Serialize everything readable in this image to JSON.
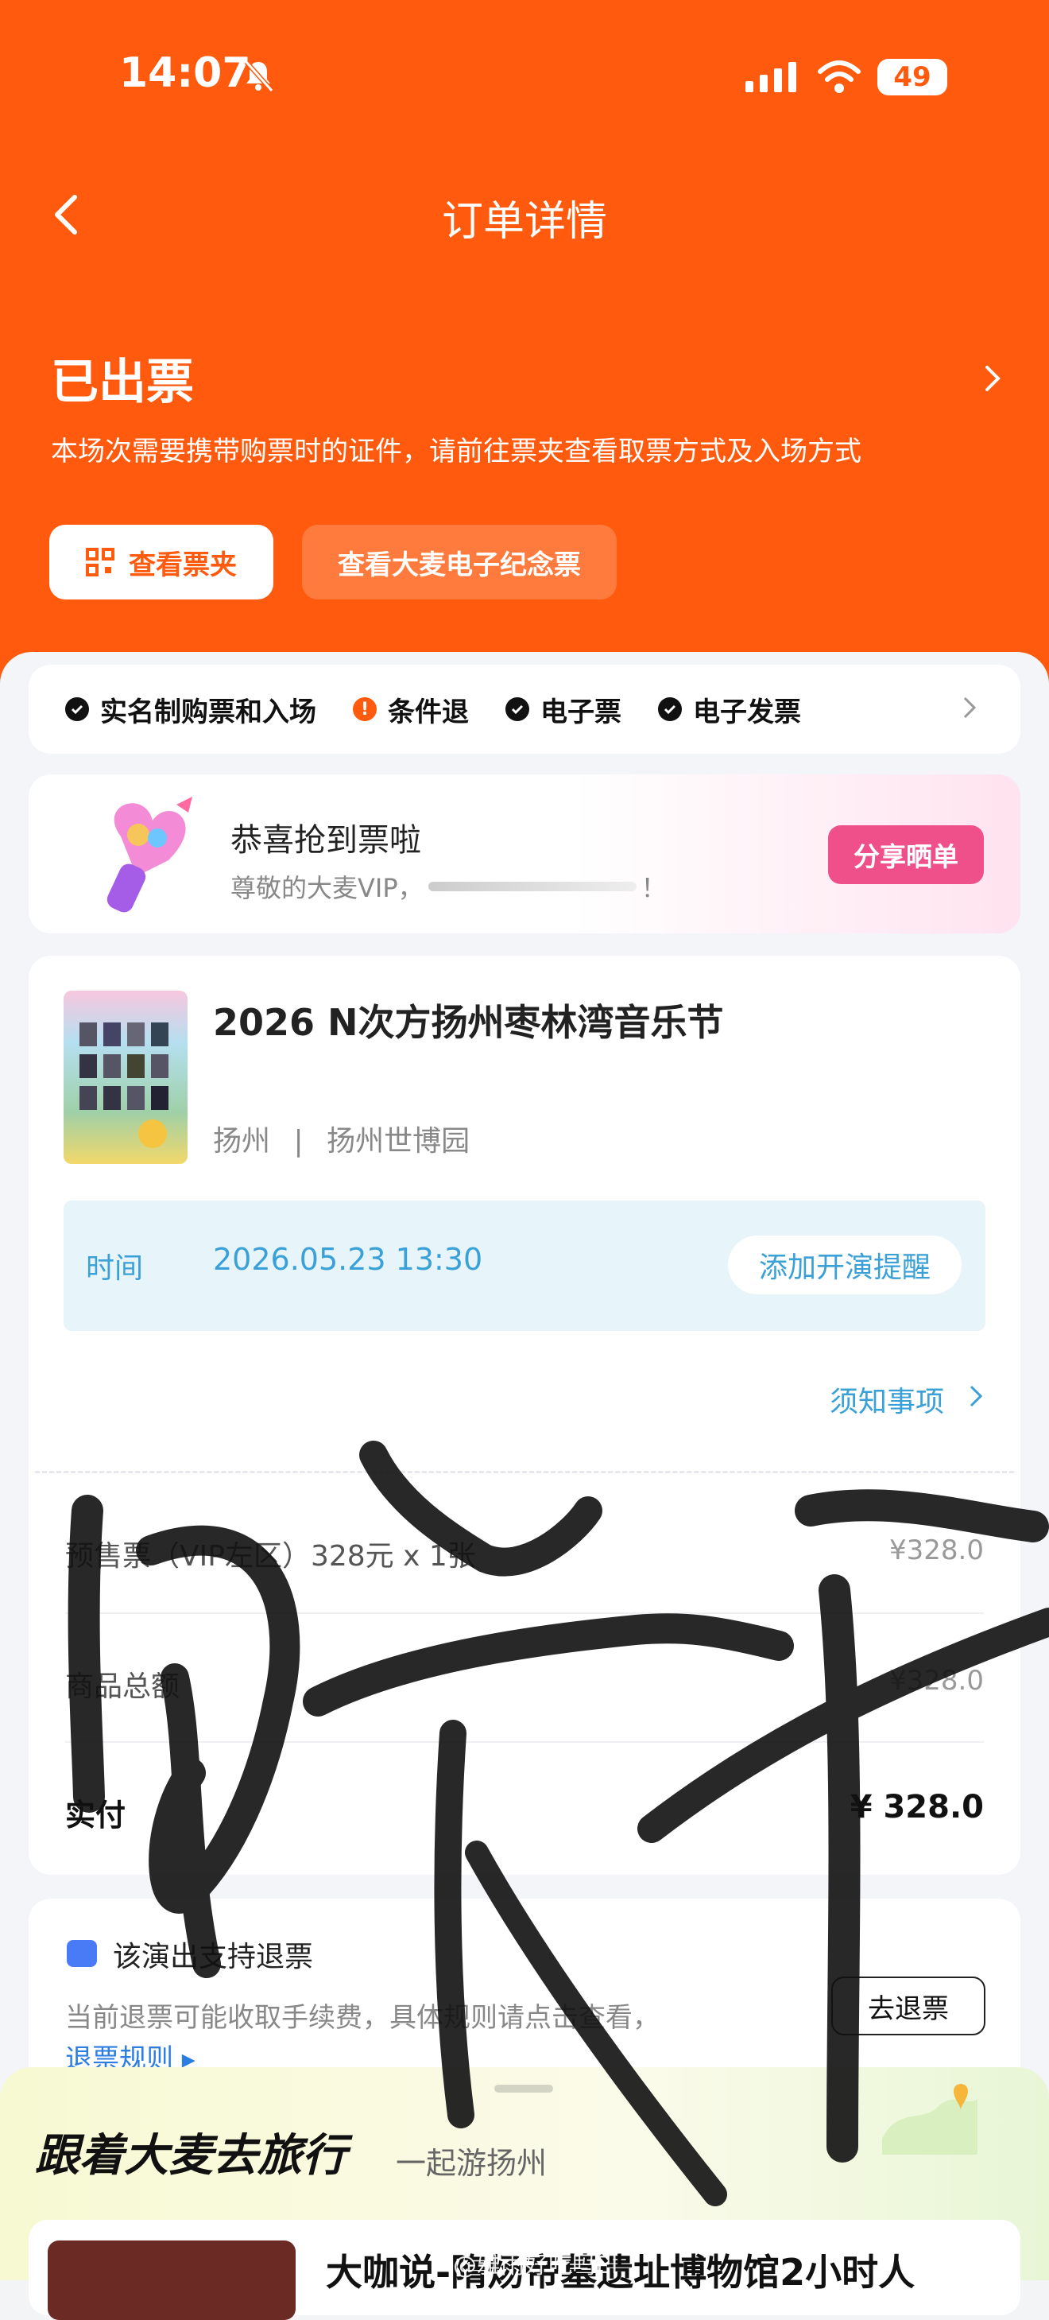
{
  "status_bar": {
    "time": "14:07",
    "battery": "49"
  },
  "header": {
    "title": "订单详情"
  },
  "order_status": {
    "title": "已出票",
    "subtitle": "本场次需要携带购票时的证件，请前往票夹查看取票方式及入场方式",
    "btn_wallet": "查看票夹",
    "btn_souvenir": "查看大麦电子纪念票"
  },
  "tags": [
    {
      "label": "实名制购票和入场",
      "icon": "check-icon"
    },
    {
      "label": "条件退",
      "icon": "warning-icon"
    },
    {
      "label": "电子票",
      "icon": "check-icon"
    },
    {
      "label": "电子发票",
      "icon": "check-icon"
    }
  ],
  "congrats": {
    "title": "恭喜抢到票啦",
    "subtitle_prefix": "尊敬的大麦VIP，",
    "subtitle_suffix": "！",
    "share": "分享晒单"
  },
  "event": {
    "title": "2026 N次方扬州枣林湾音乐节",
    "city": "扬州",
    "divider": "|",
    "venue": "扬州世博园",
    "time_label": "时间",
    "time_value": "2026.05.23 13:30",
    "remind": "添加开演提醒",
    "notice": "须知事项"
  },
  "price": {
    "ticket_label": "预售票（VIP左区）328元 x 1张",
    "ticket_value": "¥328.0",
    "total_label": "商品总额",
    "total_value": "¥328.0",
    "paid_label": "实付",
    "paid_value": "¥ 328.0"
  },
  "refund": {
    "title": "该演出支持退票",
    "text": "当前退票可能收取手续费，具体规则请点击查看，",
    "link": "退票规则 ▸",
    "button": "去退票"
  },
  "travel": {
    "title": "跟着大麦去旅行",
    "subtitle": "一起游扬州",
    "item_title": "大咖说-隋炀帝墓遗址博物馆2小时人"
  },
  "watermark": "@雅雨好吃吗El"
}
